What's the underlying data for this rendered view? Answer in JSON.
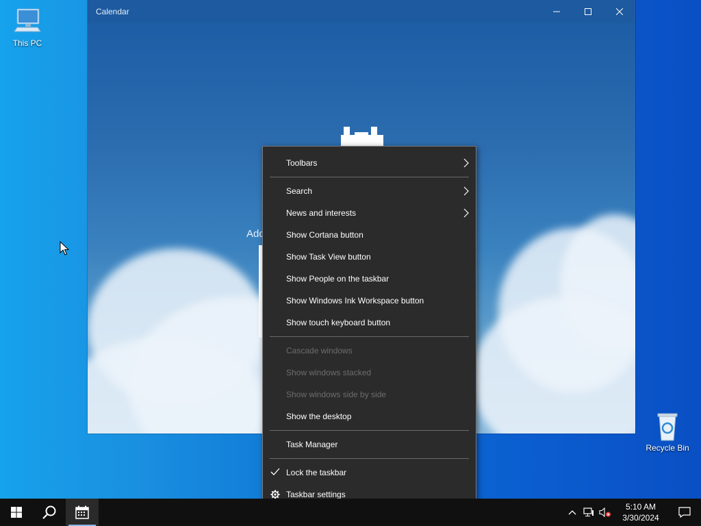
{
  "desktop": {
    "this_pc_label": "This PC",
    "recycle_bin_label": "Recycle Bin"
  },
  "window": {
    "title": "Calendar",
    "minimize_icon": "minimize-icon",
    "maximize_icon": "maximize-icon",
    "close_icon": "close-icon",
    "add_text": "Add"
  },
  "context_menu": {
    "items": [
      {
        "label": "Toolbars",
        "enabled": true,
        "submenu": true
      },
      {
        "label": "Search",
        "enabled": true,
        "submenu": true
      },
      {
        "label": "News and interests",
        "enabled": true,
        "submenu": true
      },
      {
        "label": "Show Cortana button",
        "enabled": true
      },
      {
        "label": "Show Task View button",
        "enabled": true
      },
      {
        "label": "Show People on the taskbar",
        "enabled": true
      },
      {
        "label": "Show Windows Ink Workspace button",
        "enabled": true
      },
      {
        "label": "Show touch keyboard button",
        "enabled": true
      },
      {
        "label": "Cascade windows",
        "enabled": false
      },
      {
        "label": "Show windows stacked",
        "enabled": false
      },
      {
        "label": "Show windows side by side",
        "enabled": false
      },
      {
        "label": "Show the desktop",
        "enabled": true
      },
      {
        "label": "Task Manager",
        "enabled": true
      },
      {
        "label": "Lock the taskbar",
        "enabled": true,
        "checked": true
      },
      {
        "label": "Taskbar settings",
        "enabled": true,
        "icon": "gear-icon"
      }
    ]
  },
  "taskbar": {
    "clock_time": "5:10 AM",
    "clock_date": "3/30/2024",
    "icons": [
      "windows-start-icon",
      "search-icon",
      "calendar-icon"
    ],
    "tray_icons": [
      "chevron-up-icon",
      "network-icon",
      "volume-muted-icon",
      "notification-icon"
    ]
  },
  "colors": {
    "menu_bg": "#2b2b2b",
    "menu_text": "#ffffff",
    "menu_disabled": "#6d6d6d",
    "taskbar_bg": "#101010",
    "accent": "#8ab6e8"
  }
}
